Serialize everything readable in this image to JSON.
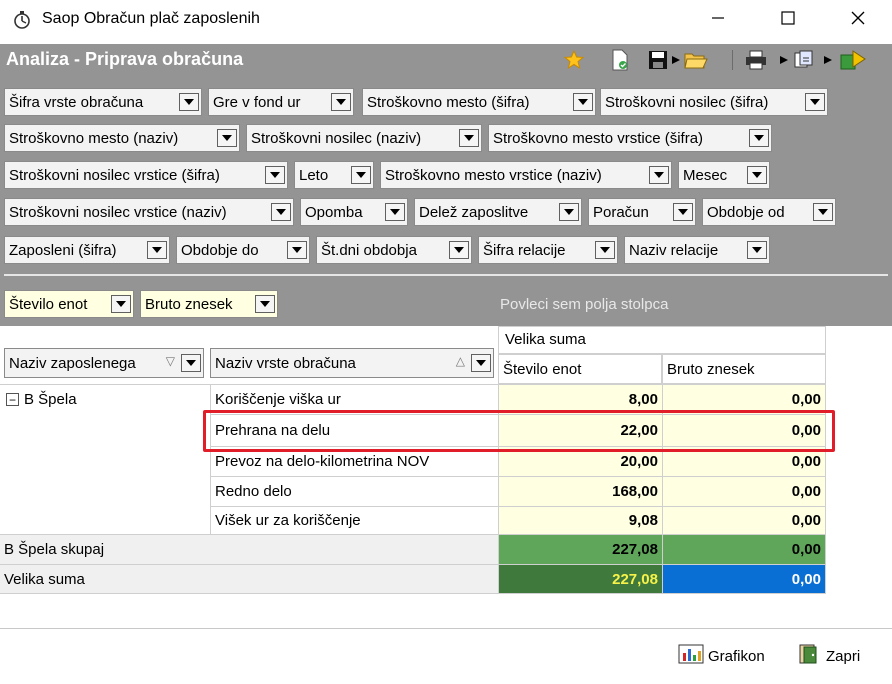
{
  "window": {
    "title": "Saop Obračun plač zaposlenih"
  },
  "header": {
    "title": "Analiza - Priprava obračuna"
  },
  "filter_fields": [
    "Šifra vrste obračuna",
    "Gre v fond ur",
    "Stroškovno mesto (šifra)",
    "Stroškovni nosilec (šifra)",
    "Stroškovno mesto (naziv)",
    "Stroškovni nosilec (naziv)",
    "Stroškovno mesto vrstice (šifra)",
    "Stroškovni nosilec vrstice (šifra)",
    "Leto",
    "Stroškovno mesto vrstice (naziv)",
    "Mesec",
    "Stroškovni nosilec vrstice (naziv)",
    "Opomba",
    "Delež zaposlitve",
    "Poračun",
    "Obdobje od",
    "Zaposleni (šifra)",
    "Obdobje do",
    "Št.dni obdobja",
    "Šifra relacije",
    "Naziv relacije"
  ],
  "data_fields": [
    "Število enot",
    "Bruto znesek"
  ],
  "column_drop_hint": "Povleci sem polja stolpca",
  "grid": {
    "col_group": "Velika suma",
    "row_headers": [
      "Naziv zaposlenega",
      "Naziv vrste obračuna"
    ],
    "value_headers": [
      "Število enot",
      "Bruto znesek"
    ],
    "employee": "B Špela",
    "rows": [
      {
        "name": "Koriščenje viška ur",
        "units": "8,00",
        "gross": "0,00"
      },
      {
        "name": "Prehrana na delu",
        "units": "22,00",
        "gross": "0,00"
      },
      {
        "name": "Prevoz na delo-kilometrina NOV",
        "units": "20,00",
        "gross": "0,00"
      },
      {
        "name": "Redno delo",
        "units": "168,00",
        "gross": "0,00"
      },
      {
        "name": "Višek ur za koriščenje",
        "units": "9,08",
        "gross": "0,00"
      }
    ],
    "subtotal": {
      "label": "B Špela skupaj",
      "units": "227,08",
      "gross": "0,00"
    },
    "grand_total": {
      "label": "Velika suma",
      "units": "227,08",
      "gross": "0,00"
    }
  },
  "buttons": {
    "chart": "Grafikon",
    "close": "Zapri"
  },
  "colors": {
    "header_bg": "#949494",
    "subtotal_green": "#5fa65a",
    "grand_green": "#3f7a3c",
    "grand_blue": "#0a6fd4",
    "highlight_red": "#e11d2a"
  }
}
